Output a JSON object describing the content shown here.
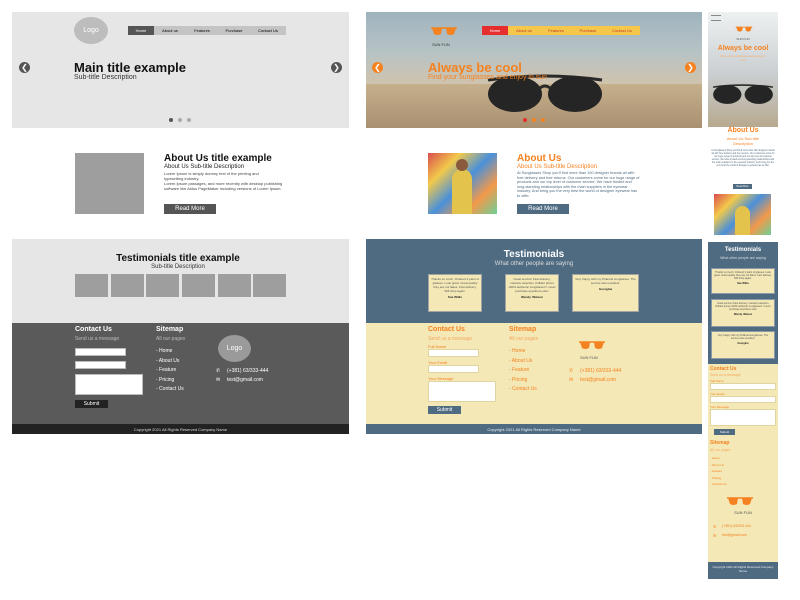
{
  "colors": {
    "orange": "#f58220",
    "teal": "#4e6b82",
    "cream": "#f3e8b6",
    "gray_dark": "#5a5a5a",
    "nav_red": "#e62e2e",
    "nav_yellow": "#f5c84c"
  },
  "wireframe": {
    "logo": "Logo",
    "nav": [
      "Home",
      "About us",
      "Features",
      "Purchase",
      "Contact Us"
    ],
    "hero_title": "Main title example",
    "hero_subtitle": "Sub-title Description",
    "about_title": "About Us title example",
    "about_subtitle": "About Us Sub-title Description",
    "about_text1": "Lorem Ipsum is simply dummy text of the printing and typesetting industry.",
    "about_text2": "Lorem Ipsum passages, and more recently with desktop publishing software like Aldus PageMaker including versions of Lorem Ipsum.",
    "read_more": "Read More",
    "testimonials_title": "Testimonials title example",
    "testimonials_subtitle": "Sub-title Description",
    "contact_title": "Contact Us",
    "contact_subtitle": "Send us a message",
    "submit": "Submit",
    "sitemap_title": "Sitemap",
    "sitemap_subtitle": "All our pages",
    "sitemap": [
      "- Home",
      "- About Us",
      "- Feature",
      "- Pricing",
      "- Contact Us"
    ],
    "phone": "(+381) 63/333-444",
    "email": "test@gmail.com",
    "copyright": "Copyright 2021 All Rights Reserved Company Name"
  },
  "desktop": {
    "brand": "SUN FUN",
    "nav": [
      "Home",
      "About us",
      "Features",
      "Purchase",
      "Contact Us"
    ],
    "hero_title": "Always be cool",
    "hero_subtitle": "Find your sunglasses and enjoy in sun",
    "about_title": "About Us",
    "about_subtitle": "About Us Sub-title Description",
    "about_text": "At Sunglasses Shop you'll find more than 100 designer brands all with free delivery and free returns. Our customers come for our huge range of products and our top level of customer service. We have trusted and long-standing relationships with the main suppliers in the eyewear industry. And bring you the very best the world of designer eyewear has to offer.",
    "read_more": "Read More",
    "testimonials_title": "Testimonials",
    "testimonials_subtitle": "What other people are saying",
    "testimonials": [
      {
        "text": "Thanks so much. Ordered 2 pairs of glasses. Look great. Great quality they are not fakes. Fast delivery. Will shop again.",
        "name": "Sue Wilks"
      },
      {
        "text": "Great service! Fast delivery, massive selection, brilliant prices 100% authentic sunglasses! I never purchase anywhere else!",
        "name": "Wendy. Watson"
      },
      {
        "text": "Very happy with my Polaroid sunglasses. The service was excellent.",
        "name": "Georgina"
      }
    ],
    "contact_title": "Contact Us",
    "contact_subtitle": "Send us a message",
    "full_name": "Full Name",
    "email_label": "Your Email",
    "message_label": "Your Message",
    "submit": "Submit",
    "sitemap_title": "Sitemap",
    "sitemap_subtitle": "All our pages",
    "sitemap": [
      "- Home",
      "- About Us",
      "- Feature",
      "- Pricing",
      "- Contact Us"
    ],
    "phone": "(+381) 63/333-444",
    "email": "test@gmail.com",
    "copyright": "Copyright 2021 All Rights Reserved Company Name"
  },
  "mobile": {
    "brand": "SUN FUN",
    "hero_title": "Always be cool",
    "hero_subtitle": "Find your sunglasses and enjoy in sun",
    "about_title": "About Us",
    "about_subtitle": "About Us Sub-title Description",
    "about_text": "At Sunglasses Shop you'll find more than 100 designer brands all with free delivery and free returns. Our customers come for our huge range of products and our top level of customer service. We have trusted and long-standing relationships with the main suppliers in the eyewear industry. And bring you the very best the world of designer eyewear has to offer.",
    "read_more": "Read More",
    "testimonials_title": "Testimonials",
    "testimonials_subtitle": "What other people are saying",
    "testimonials": [
      {
        "text": "Thanks so much. Ordered 2 pairs of glasses. Look great. Great quality they are not fakes. Fast delivery. Will shop again.",
        "name": "Sue Wilks"
      },
      {
        "text": "Great service! Fast delivery, massive selection, brilliant prices 100% authentic sunglasses! I never purchase anywhere else!",
        "name": "Wendy. Watson"
      },
      {
        "text": "Very happy with my Polaroid sunglasses. The service was excellent.",
        "name": "Georgina"
      }
    ],
    "contact_title": "Contact Us",
    "contact_subtitle": "Send us a message",
    "full_name": "Full Name",
    "email_label": "Your Email",
    "message_label": "Your Message",
    "submit": "Submit",
    "sitemap_title": "Sitemap",
    "sitemap_subtitle": "All our pages",
    "sitemap": [
      "- Home",
      "- About Us",
      "- Feature",
      "- Pricing",
      "- Contact Us"
    ],
    "phone": "(+381) 63/333-444",
    "email": "test@gmail.com",
    "copyright": "Copyright 2021 All Rights Reserved Company Name"
  }
}
